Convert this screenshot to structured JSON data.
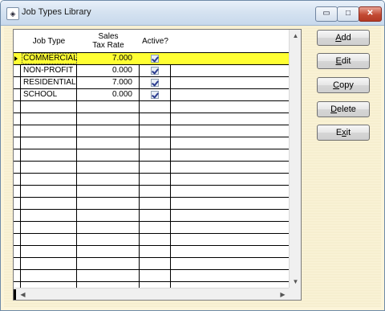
{
  "window": {
    "title": "Job Types Library",
    "min_glyph": "▭",
    "max_glyph": "□",
    "close_glyph": "✕"
  },
  "grid": {
    "columns": [
      {
        "line1": "Job Type",
        "line2": ""
      },
      {
        "line1": "Sales",
        "line2": "Tax Rate"
      },
      {
        "line1": "Active?",
        "line2": ""
      }
    ],
    "rows": [
      {
        "job_type": "COMMERCIAL",
        "rate": "7.000",
        "active": true,
        "selected": true
      },
      {
        "job_type": "NON-PROFIT",
        "rate": "0.000",
        "active": true,
        "selected": false
      },
      {
        "job_type": "RESIDENTIAL",
        "rate": "7.000",
        "active": true,
        "selected": false
      },
      {
        "job_type": "SCHOOL",
        "rate": "0.000",
        "active": true,
        "selected": false
      }
    ],
    "scroll_up": "▲",
    "scroll_down": "▼",
    "scroll_left": "◀",
    "scroll_right": "▶"
  },
  "buttons": {
    "add": {
      "mnemonic": "A",
      "rest": "dd"
    },
    "edit": {
      "mnemonic": "E",
      "rest": "dit"
    },
    "copy": {
      "mnemonic": "C",
      "rest": "opy"
    },
    "delete": {
      "mnemonic": "D",
      "rest": "elete"
    },
    "exit": {
      "pre": "E",
      "mnemonic": "x",
      "rest": "it"
    }
  },
  "colors": {
    "selected_row": "#ffff33",
    "client_background": "#fbf4d9"
  }
}
